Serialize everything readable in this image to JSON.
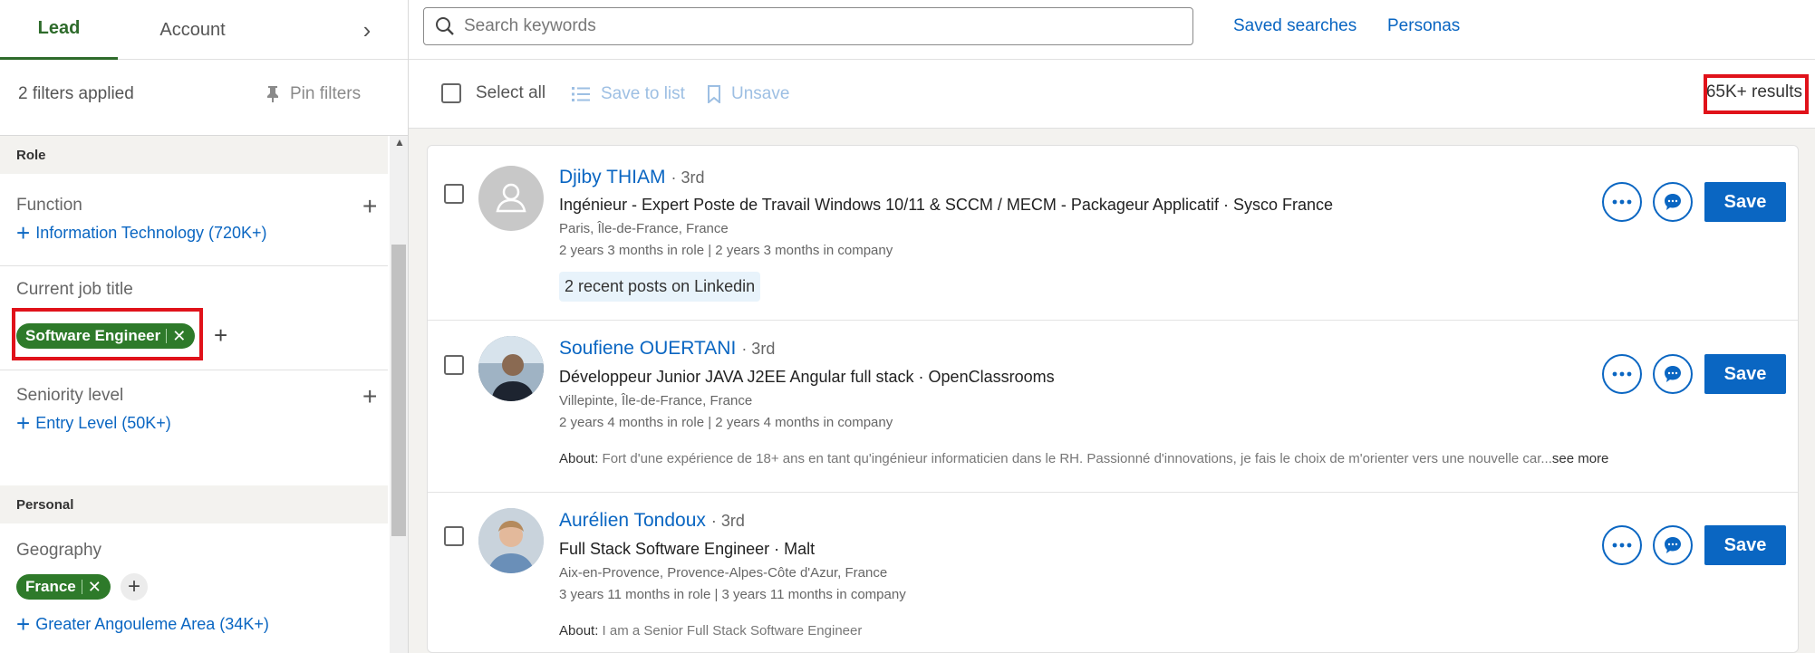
{
  "tabs": {
    "lead": "Lead",
    "account": "Account",
    "chevron": "›"
  },
  "filters": {
    "applied": "2 filters applied",
    "pin": "Pin filters"
  },
  "sections": {
    "role": "Role",
    "personal": "Personal"
  },
  "role": {
    "function_label": "Function",
    "function_option": "Information Technology (720K+)",
    "job_title_label": "Current job title",
    "job_title_pill": "Software Engineer",
    "seniority_label": "Seniority level",
    "seniority_option": "Entry Level (50K+)"
  },
  "personal": {
    "geography_label": "Geography",
    "geography_pill": "France",
    "geography_option": "Greater Angouleme Area (34K+)"
  },
  "topbar": {
    "search_placeholder": "Search keywords",
    "saved_searches": "Saved searches",
    "personas": "Personas"
  },
  "actionbar": {
    "select_all": "Select all",
    "save_to_list": "Save to list",
    "unsave": "Unsave",
    "results": "65K+ results"
  },
  "leads": [
    {
      "name": "Djiby THIAM",
      "degree": "· 3rd",
      "headline": "Ingénieur - Expert Poste de Travail Windows 10/11 & SCCM / MECM - Packageur Applicatif · Sysco France",
      "location": "Paris, Île-de-France, France",
      "tenure": "2 years 3 months in role | 2 years 3 months in company",
      "recent": "2 recent posts on Linkedin",
      "save": "Save"
    },
    {
      "name": "Soufiene OUERTANI",
      "degree": "· 3rd",
      "headline": "Développeur Junior JAVA J2EE Angular full stack · OpenClassrooms",
      "location": "Villepinte, Île-de-France, France",
      "tenure": "2 years 4 months in role | 2 years 4 months in company",
      "about_label": "About:",
      "about": "Fort d'une expérience de 18+ ans en tant qu'ingénieur informaticien dans le RH. Passionné d'innovations, je fais le choix de m'orienter vers une nouvelle car...",
      "see_more": "see more",
      "save": "Save"
    },
    {
      "name": "Aurélien Tondoux",
      "degree": "· 3rd",
      "headline": "Full Stack Software Engineer · Malt",
      "location": "Aix-en-Provence, Provence-Alpes-Côte d'Azur, France",
      "tenure": "3 years 11 months in role | 3 years 11 months in company",
      "about_label": "About:",
      "about": "I am a Senior Full Stack Software Engineer",
      "save": "Save"
    }
  ],
  "colors": {
    "brand_blue": "#0a66c2",
    "filter_green": "#2e7a2a",
    "highlight_red": "#e0121a"
  }
}
